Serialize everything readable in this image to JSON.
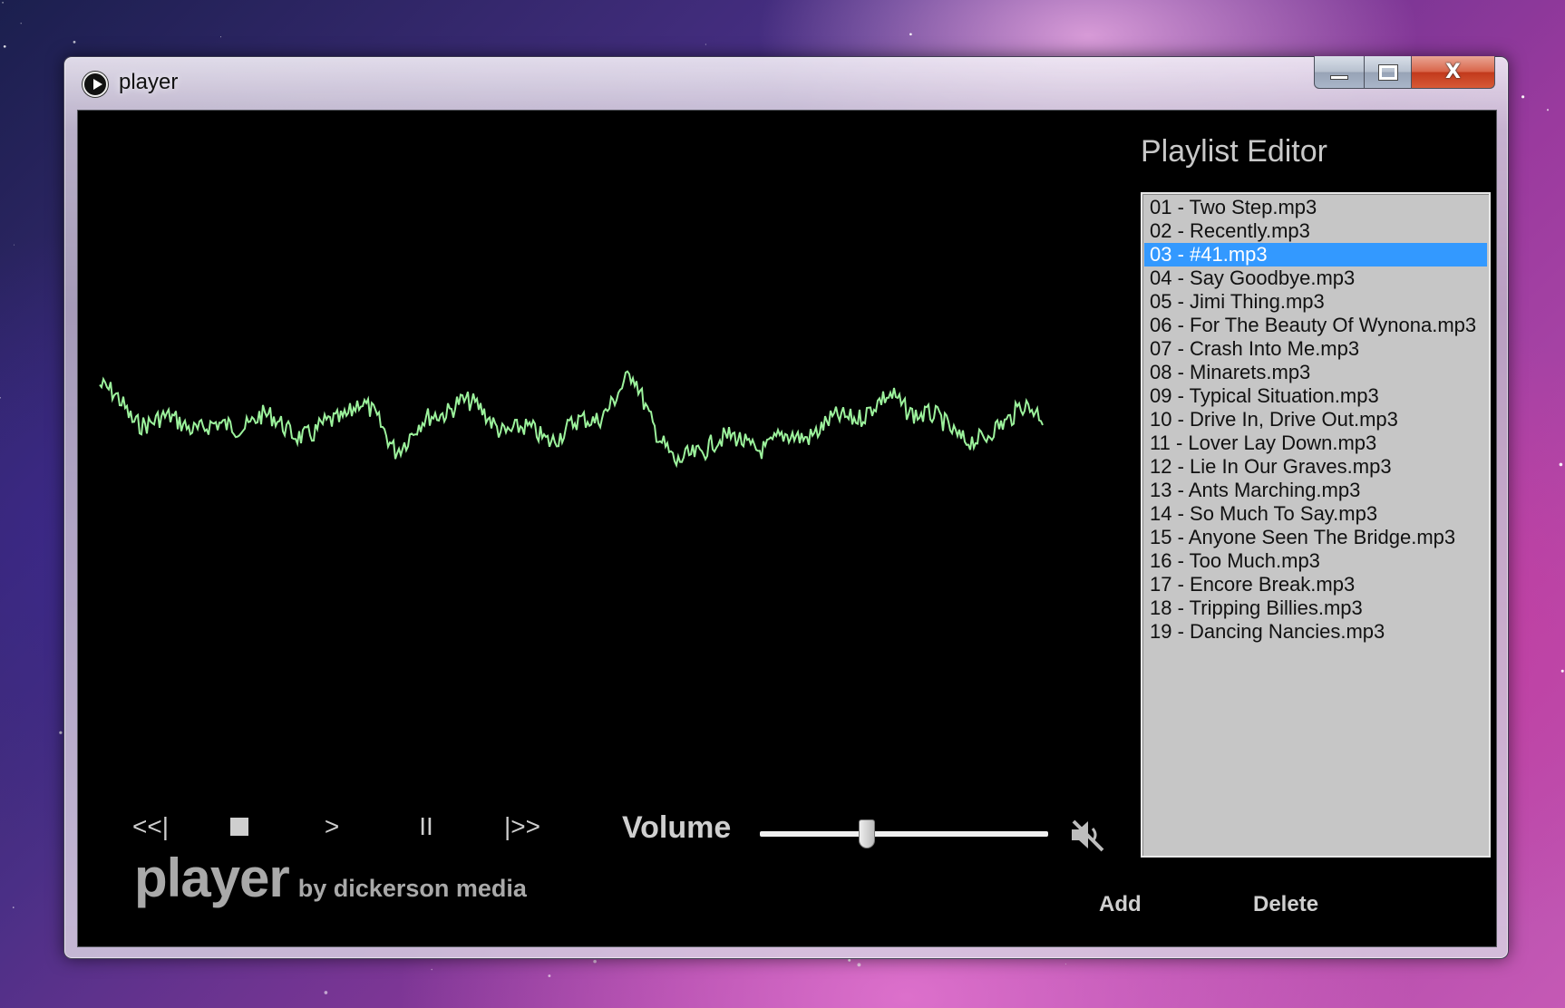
{
  "window": {
    "title": "player",
    "icon": "play-circle-icon",
    "caption_buttons": [
      "minimize-icon",
      "maximize-icon",
      "close-icon"
    ],
    "close_glyph": "X"
  },
  "controls": {
    "previous": "<<|",
    "stop_icon": "stop-icon",
    "play": ">",
    "pause": "II",
    "next": "|>>",
    "volume_label": "Volume",
    "volume_level": 0.37,
    "mute_icon": "speaker-muted-icon"
  },
  "branding": {
    "name": "player",
    "byline": "by dickerson media"
  },
  "playlist": {
    "title": "Playlist Editor",
    "selected_index": 2,
    "items": [
      "01 - Two Step.mp3",
      "02 - Recently.mp3",
      "03 - #41.mp3",
      "04 - Say Goodbye.mp3",
      "05 - Jimi Thing.mp3",
      "06 - For The Beauty Of Wynona.mp3",
      "07 - Crash Into Me.mp3",
      "08 - Minarets.mp3",
      "09 - Typical Situation.mp3",
      "10 - Drive In, Drive Out.mp3",
      "11 - Lover Lay Down.mp3",
      "12 - Lie In Our Graves.mp3",
      "13 - Ants Marching.mp3",
      "14 - So Much To Say.mp3",
      "15 - Anyone Seen The Bridge.mp3",
      "16 - Too Much.mp3",
      "17 - Encore Break.mp3",
      "18 - Tripping Billies.mp3",
      "19 - Dancing Nancies.mp3"
    ],
    "add_label": "Add",
    "delete_label": "Delete"
  },
  "colors": {
    "waveform": "#9cf29c",
    "selection": "#3399ff",
    "text_light": "#cfcfcf",
    "client_bg": "#000000"
  }
}
